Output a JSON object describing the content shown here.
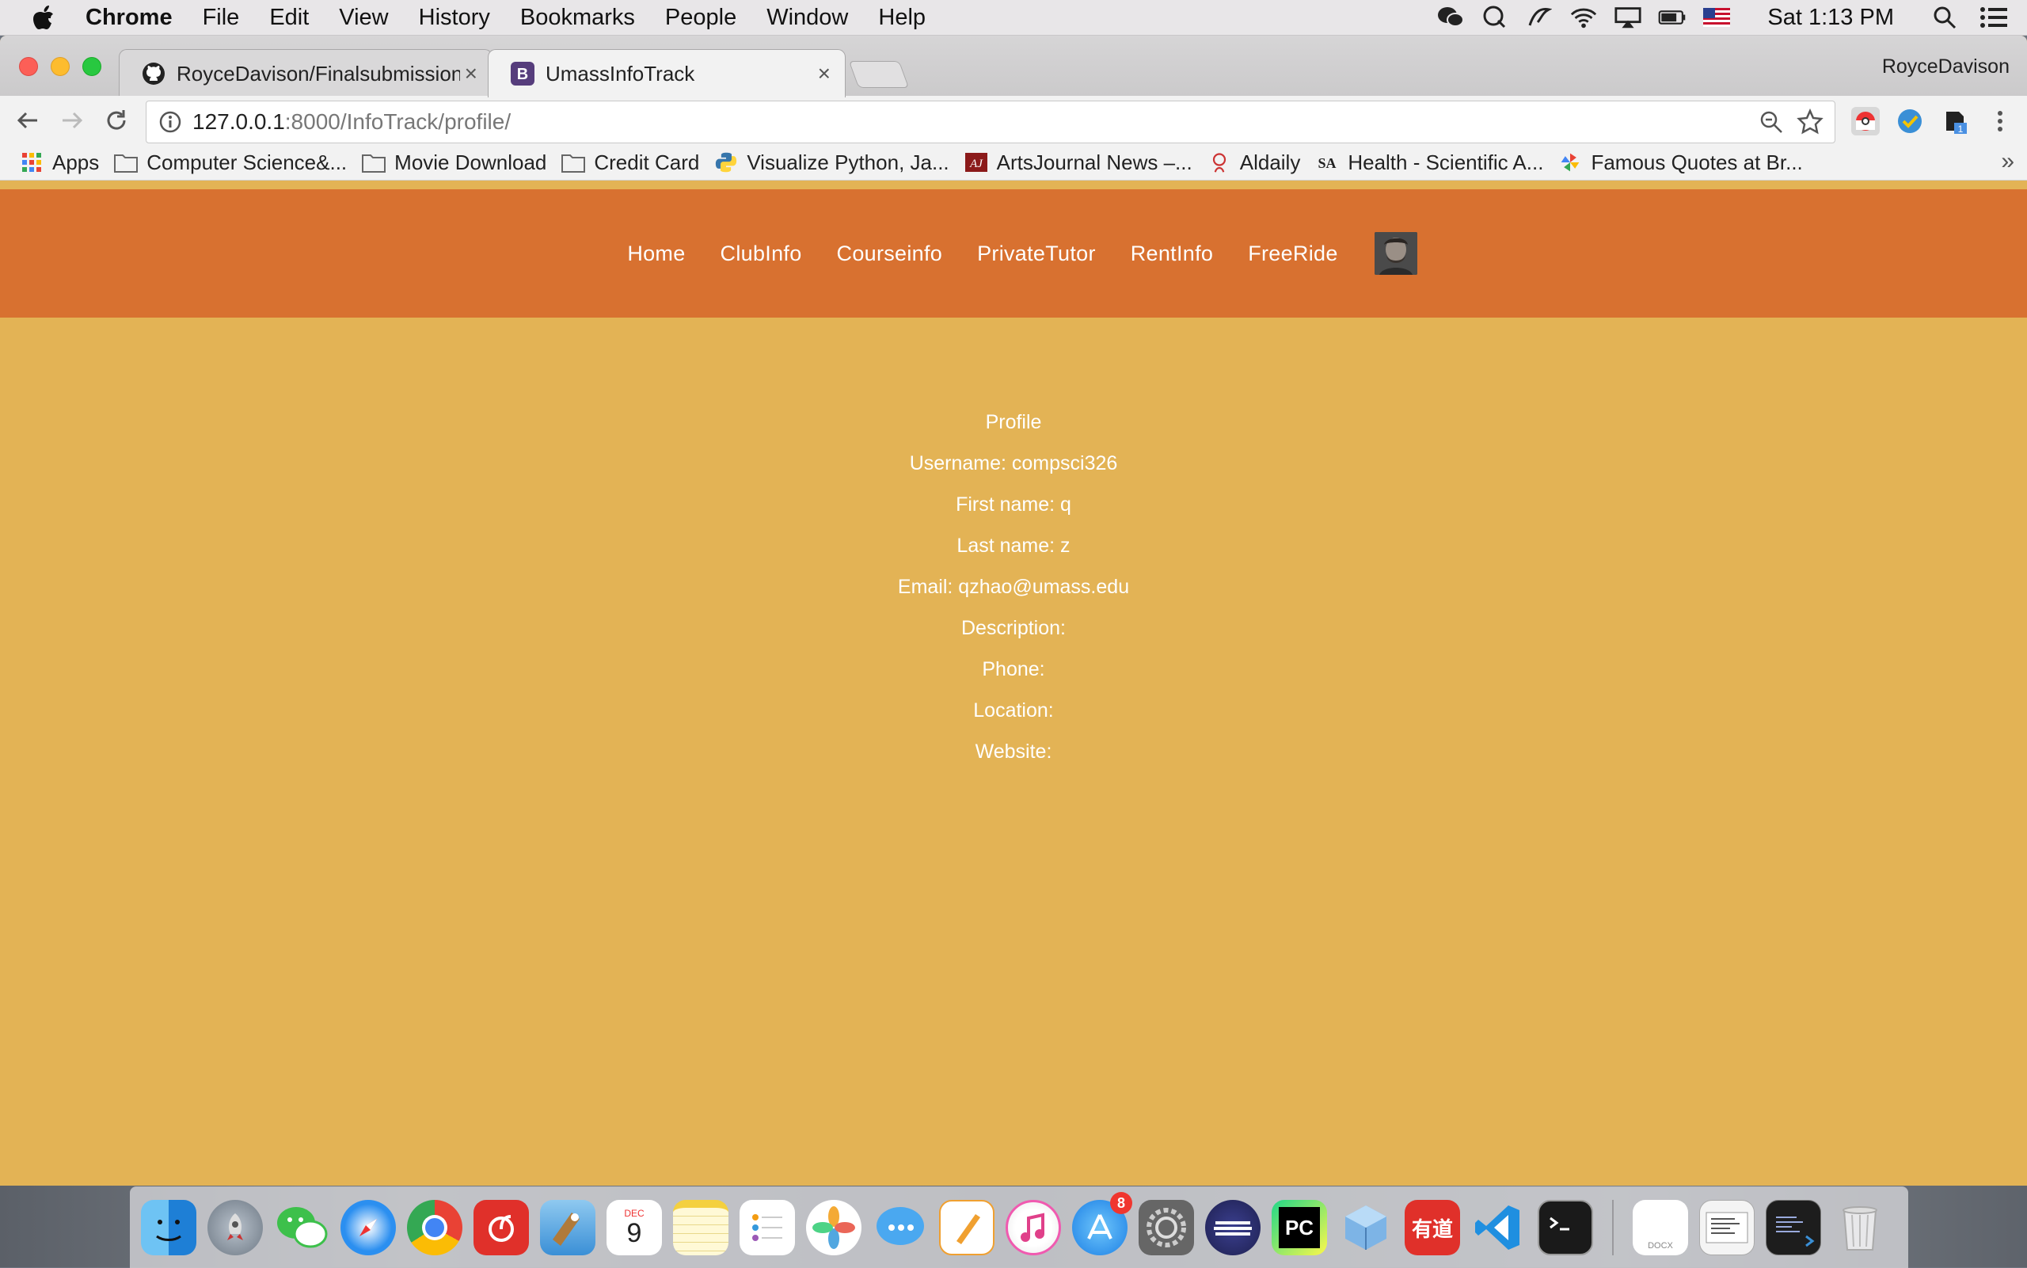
{
  "menubar": {
    "app_name": "Chrome",
    "items": [
      "File",
      "Edit",
      "View",
      "History",
      "Bookmarks",
      "People",
      "Window",
      "Help"
    ],
    "clock": "Sat 1:13 PM",
    "tray_icons": [
      "wechat-icon",
      "qq-icon",
      "script-icon",
      "wifi-icon",
      "airplay-icon",
      "battery-icon",
      "us-flag-icon",
      "spotlight-icon",
      "notification-center-icon"
    ]
  },
  "browser": {
    "tabs": [
      {
        "title": "RoyceDavison/Finalsubmission",
        "icon": "github-icon",
        "active": false
      },
      {
        "title": "UmassInfoTrack",
        "icon": "bootstrap-icon",
        "active": true
      }
    ],
    "profile_name": "RoyceDavison",
    "url_host": "127.0.0.1",
    "url_rest": ":8000/InfoTrack/profile/",
    "bookmarks": [
      {
        "label": "Apps",
        "icon": "apps-grid-icon"
      },
      {
        "label": "Computer Science&...",
        "icon": "folder-icon"
      },
      {
        "label": "Movie Download",
        "icon": "folder-icon"
      },
      {
        "label": "Credit Card",
        "icon": "folder-icon"
      },
      {
        "label": "Visualize Python, Ja...",
        "icon": "python-icon"
      },
      {
        "label": "ArtsJournal News –...",
        "icon": "artsjournal-icon"
      },
      {
        "label": "Aldaily",
        "icon": "aldaily-icon"
      },
      {
        "label": "Health - Scientific A...",
        "icon": "scientific-american-icon"
      },
      {
        "label": "Famous Quotes at Br...",
        "icon": "pinwheel-icon"
      }
    ],
    "bookmarks_more": "»"
  },
  "site": {
    "nav": [
      "Home",
      "ClubInfo",
      "Courseinfo",
      "PrivateTutor",
      "RentInfo",
      "FreeRide"
    ],
    "profile": {
      "heading": "Profile",
      "username": "Username: compsci326",
      "first_name": "First name: q",
      "last_name": "Last name: z",
      "email": "Email: qzhao@umass.edu",
      "description": "Description:",
      "phone": "Phone:",
      "location": "Location:",
      "website": "Website:"
    }
  },
  "dock": {
    "apps": [
      "finder-icon",
      "launchpad-icon",
      "wechat-icon",
      "safari-icon",
      "chrome-icon",
      "netease-music-icon",
      "mail-icon",
      "calendar-icon",
      "notes-icon",
      "reminders-icon",
      "photos-icon",
      "messages-icon",
      "pages-icon",
      "itunes-icon",
      "app-store-icon",
      "system-preferences-icon",
      "eclipse-icon",
      "pycharm-icon",
      "virtualbox-icon",
      "youdao-icon",
      "vscode-icon",
      "terminal-icon"
    ],
    "calendar_month": "DEC",
    "calendar_day": "9",
    "app_store_badge": "8",
    "youdao_label": "有道",
    "pycharm_label": "PC",
    "docx_label": "DOCX",
    "stack_items": [
      "docx-file-icon",
      "screenshot-stack-icon",
      "screenshot-stack-icon",
      "trash-icon"
    ]
  }
}
